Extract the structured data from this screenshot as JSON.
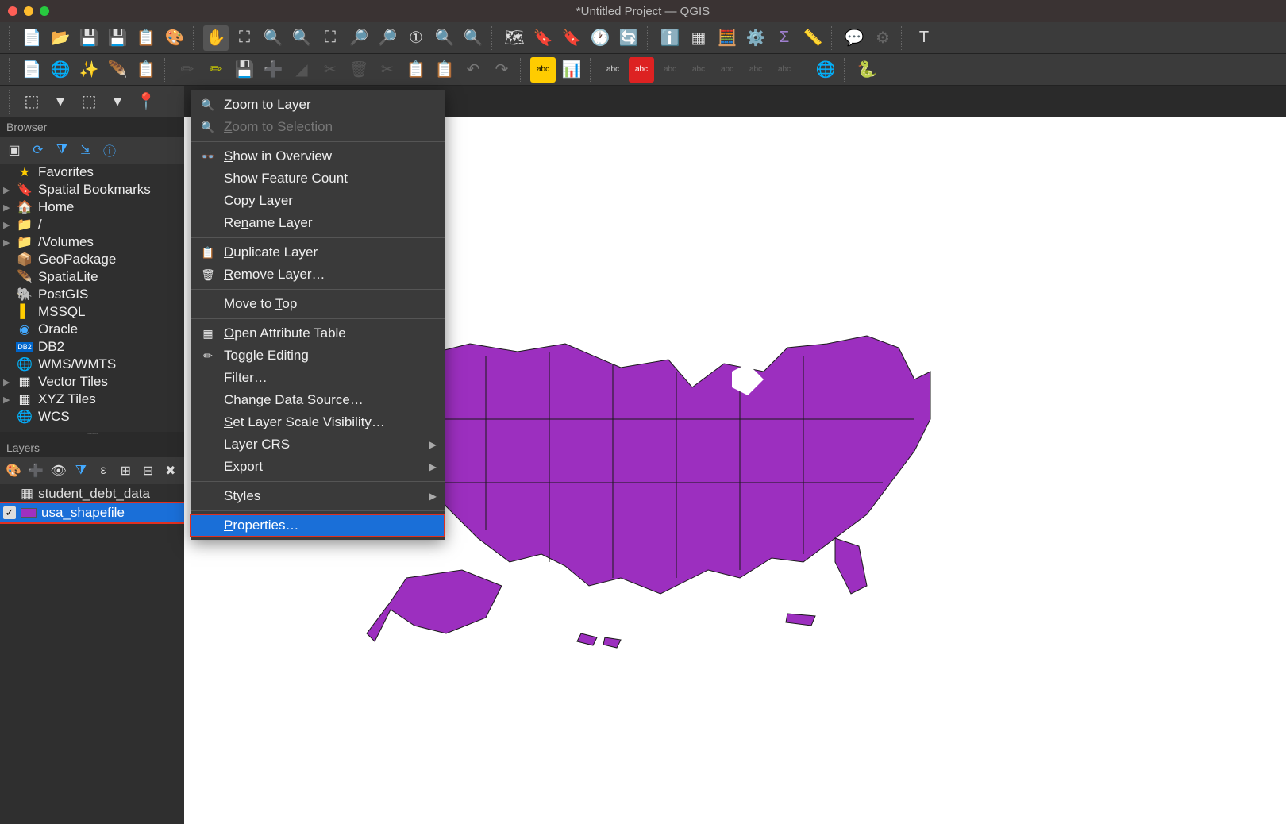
{
  "window": {
    "title": "*Untitled Project — QGIS"
  },
  "browser": {
    "title": "Browser",
    "items": [
      {
        "icon": "★",
        "label": "Favorites",
        "arrow": ""
      },
      {
        "icon": "🔖",
        "label": "Spatial Bookmarks",
        "arrow": "▶"
      },
      {
        "icon": "🏠",
        "label": "Home",
        "arrow": "▶"
      },
      {
        "icon": "📁",
        "label": "/",
        "arrow": "▶"
      },
      {
        "icon": "📁",
        "label": "/Volumes",
        "arrow": "▶"
      },
      {
        "icon": "📦",
        "label": "GeoPackage",
        "arrow": ""
      },
      {
        "icon": "🪶",
        "label": "SpatiaLite",
        "arrow": ""
      },
      {
        "icon": "🐘",
        "label": "PostGIS",
        "arrow": ""
      },
      {
        "icon": "▌",
        "label": "MSSQL",
        "arrow": ""
      },
      {
        "icon": "◉",
        "label": "Oracle",
        "arrow": ""
      },
      {
        "icon": "DB2",
        "label": "DB2",
        "arrow": ""
      },
      {
        "icon": "🌐",
        "label": "WMS/WMTS",
        "arrow": ""
      },
      {
        "icon": "▦",
        "label": "Vector Tiles",
        "arrow": "▶"
      },
      {
        "icon": "▦",
        "label": "XYZ Tiles",
        "arrow": "▶"
      },
      {
        "icon": "🌐",
        "label": "WCS",
        "arrow": ""
      }
    ]
  },
  "layers": {
    "title": "Layers",
    "items": [
      {
        "icon": "▦",
        "name": "student_debt_data",
        "checked": false,
        "selected": false
      },
      {
        "icon": "■",
        "name": "usa_shapefile",
        "checked": true,
        "selected": true
      }
    ]
  },
  "context_menu": [
    {
      "icon": "🔍",
      "label": "Zoom to Layer",
      "u": "Z"
    },
    {
      "icon": "🔍",
      "label": "Zoom to Selection",
      "u": "Z",
      "disabled": true
    },
    {
      "sep": true
    },
    {
      "icon": "👓",
      "label": "Show in Overview",
      "u": "S"
    },
    {
      "icon": "",
      "label": "Show Feature Count"
    },
    {
      "icon": "",
      "label": "Copy Layer"
    },
    {
      "icon": "",
      "label": "Rename Layer",
      "u": "n"
    },
    {
      "sep": true
    },
    {
      "icon": "📋",
      "label": "Duplicate Layer",
      "u": "D"
    },
    {
      "icon": "🗑",
      "label": "Remove Layer…",
      "u": "R"
    },
    {
      "sep": true
    },
    {
      "icon": "",
      "label": "Move to Top",
      "u": "T"
    },
    {
      "sep": true
    },
    {
      "icon": "▦",
      "label": "Open Attribute Table",
      "u": "O"
    },
    {
      "icon": "✏",
      "label": "Toggle Editing"
    },
    {
      "icon": "",
      "label": "Filter…",
      "u": "F"
    },
    {
      "icon": "",
      "label": "Change Data Source…"
    },
    {
      "icon": "",
      "label": "Set Layer Scale Visibility…",
      "u": "S"
    },
    {
      "icon": "",
      "label": "Layer CRS",
      "submenu": true
    },
    {
      "icon": "",
      "label": "Export",
      "submenu": true
    },
    {
      "sep": true
    },
    {
      "icon": "",
      "label": "Styles",
      "submenu": true
    },
    {
      "sep": true
    },
    {
      "icon": "",
      "label": "Properties…",
      "u": "P",
      "highlight": true
    }
  ],
  "colors": {
    "map_fill": "#9c2fbf",
    "selection": "#1a6fd8",
    "annotation": "#e03020"
  }
}
